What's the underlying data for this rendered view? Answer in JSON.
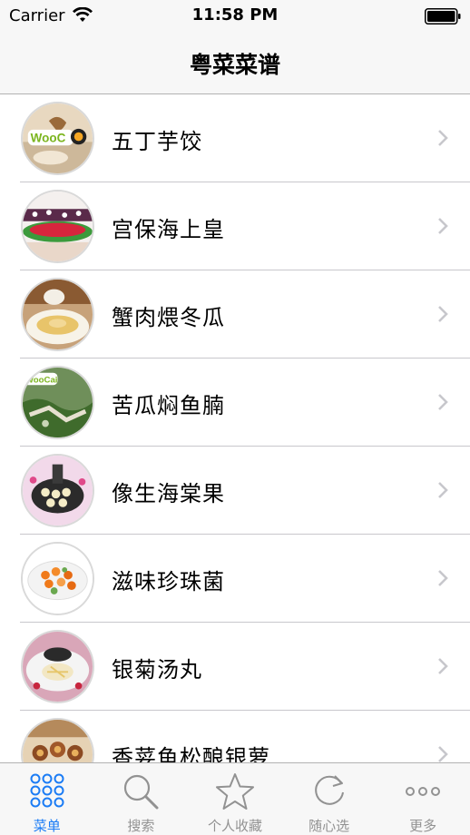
{
  "status_bar": {
    "carrier": "Carrier",
    "time": "11:58 PM"
  },
  "nav": {
    "title": "粤菜菜谱"
  },
  "recipes": [
    {
      "name": "五丁芋饺",
      "thumb": "wooc-logo-dish"
    },
    {
      "name": "宫保海上皇",
      "thumb": "purple-platter-dish"
    },
    {
      "name": "蟹肉煨冬瓜",
      "thumb": "soup-bowl-dish"
    },
    {
      "name": "苦瓜焖鱼腩",
      "thumb": "greens-dish"
    },
    {
      "name": "像生海棠果",
      "thumb": "pink-dessert-dish"
    },
    {
      "name": "滋味珍珠菌",
      "thumb": "orange-mushroom-dish"
    },
    {
      "name": "银菊汤丸",
      "thumb": "dumpling-plate-dish"
    },
    {
      "name": "香荽鱼松酿银萝",
      "thumb": "brown-stew-dish"
    }
  ],
  "tabs": [
    {
      "label": "菜单",
      "icon": "grid-dots-icon",
      "active": true
    },
    {
      "label": "搜索",
      "icon": "search-icon",
      "active": false
    },
    {
      "label": "个人收藏",
      "icon": "star-icon",
      "active": false
    },
    {
      "label": "随心选",
      "icon": "refresh-icon",
      "active": false
    },
    {
      "label": "更多",
      "icon": "more-icon",
      "active": false
    }
  ],
  "colors": {
    "accent": "#1b7cf5",
    "inactive": "#929292",
    "bar_background": "#f7f7f7"
  }
}
